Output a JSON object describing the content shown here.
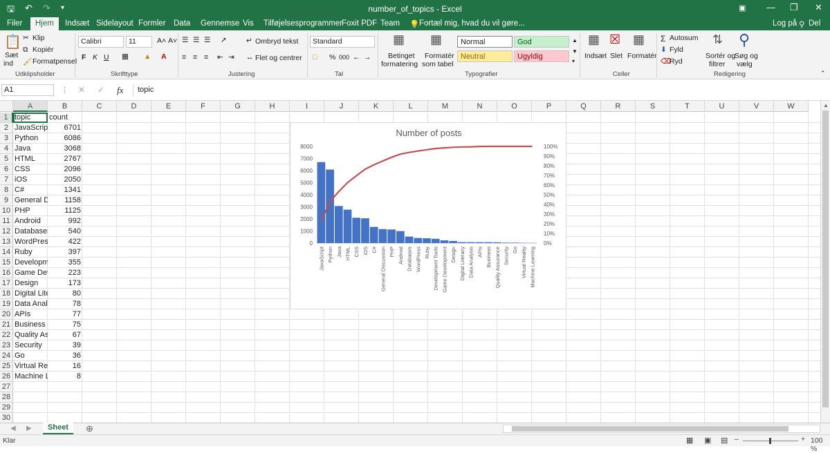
{
  "window": {
    "title": "number_of_topics - Excel",
    "user_label": "Log på",
    "share_label": "Del"
  },
  "menu": {
    "tabs": [
      "Filer",
      "Hjem",
      "Indsæt",
      "Sidelayout",
      "Formler",
      "Data",
      "Gennemse",
      "Vis",
      "Tilføjelsesprogrammer",
      "Foxit PDF",
      "Team"
    ],
    "active": "Hjem",
    "tellme": "Fortæl mig, hvad du vil gøre..."
  },
  "ribbon": {
    "clipboard": {
      "paste": "Sæt",
      "paste2": "ind",
      "cut": "Klip",
      "copy": "Kopiér",
      "format_painter": "Formatpensel",
      "group": "Udklipsholder"
    },
    "font": {
      "name": "Calibri",
      "size": "11",
      "bold": "F",
      "italic": "K",
      "underline": "U",
      "group": "Skrifttype"
    },
    "alignment": {
      "wrap": "Ombryd tekst",
      "merge": "Flet og centrer",
      "group": "Justering"
    },
    "number": {
      "format": "Standard",
      "percent": "%",
      "comma": "000",
      "group": "Tal"
    },
    "styles": {
      "conditional": "Betinget",
      "conditional2": "formatering",
      "as_table": "Formatér",
      "as_table2": "som tabel",
      "normal": "Normal",
      "good": "God",
      "neutral": "Neutral",
      "bad": "Ugyldig",
      "group": "Typografier"
    },
    "cells": {
      "insert": "Indsæt",
      "delete": "Slet",
      "format": "Formatér",
      "group": "Celler"
    },
    "editing": {
      "autosum": "Autosum",
      "fill": "Fyld",
      "clear": "Ryd",
      "sort": "Sortér og",
      "sort2": "filtrer",
      "find": "Søg og",
      "find2": "vælg",
      "group": "Redigering"
    }
  },
  "formula_bar": {
    "name_box": "A1",
    "fx": "fx",
    "content": "topic"
  },
  "columns": [
    "A",
    "B",
    "C",
    "D",
    "E",
    "F",
    "G",
    "H",
    "I",
    "J",
    "K",
    "L",
    "M",
    "N",
    "O",
    "P",
    "Q",
    "R",
    "S",
    "T",
    "U",
    "V",
    "W"
  ],
  "rows": [
    "1",
    "2",
    "3",
    "4",
    "5",
    "6",
    "7",
    "8",
    "9",
    "10",
    "11",
    "12",
    "13",
    "14",
    "15",
    "16",
    "17",
    "18",
    "19",
    "20",
    "21",
    "22",
    "23",
    "24",
    "25",
    "26",
    "27",
    "28",
    "29",
    "30"
  ],
  "cells": [
    [
      "topic",
      "count"
    ],
    [
      "JavaScript",
      "6701"
    ],
    [
      "Python",
      "6086"
    ],
    [
      "Java",
      "3068"
    ],
    [
      "HTML",
      "2767"
    ],
    [
      "CSS",
      "2096"
    ],
    [
      "iOS",
      "2050"
    ],
    [
      "C#",
      "1341"
    ],
    [
      "General Di",
      "1158"
    ],
    [
      "PHP",
      "1125"
    ],
    [
      "Android",
      "992"
    ],
    [
      "Databases",
      "540"
    ],
    [
      "WordPress",
      "422"
    ],
    [
      "Ruby",
      "397"
    ],
    [
      "Developme",
      "355"
    ],
    [
      "Game Dev",
      "223"
    ],
    [
      "Design",
      "173"
    ],
    [
      "Digital Lite",
      "80"
    ],
    [
      "Data Analy",
      "78"
    ],
    [
      "APIs",
      "77"
    ],
    [
      "Business",
      "75"
    ],
    [
      "Quality Ass",
      "67"
    ],
    [
      "Security",
      "39"
    ],
    [
      "Go",
      "36"
    ],
    [
      "Virtual Rea",
      "16"
    ],
    [
      "Machine L",
      "8"
    ]
  ],
  "chart_data": {
    "type": "bar",
    "title": "Number of posts",
    "categories": [
      "JavaScript",
      "Python",
      "Java",
      "HTML",
      "CSS",
      "iOS",
      "C#",
      "General Discussion",
      "PHP",
      "Android",
      "Databases",
      "WordPress",
      "Ruby",
      "Development Tools",
      "Game Development",
      "Design",
      "Digital Literacy",
      "Data Analysis",
      "APIs",
      "Business",
      "Quality Assurance",
      "Security",
      "Go",
      "Virtual Reality",
      "Machine Learning"
    ],
    "series": [
      {
        "type": "bar",
        "axis": "left",
        "color": "#4472c4",
        "values": [
          6701,
          6086,
          3068,
          2767,
          2096,
          2050,
          1341,
          1158,
          1125,
          992,
          540,
          422,
          397,
          355,
          223,
          173,
          80,
          78,
          77,
          75,
          67,
          39,
          36,
          16,
          8
        ]
      },
      {
        "type": "line",
        "axis": "right",
        "color": "#c0504d",
        "values": [
          22.5,
          43.0,
          53.3,
          62.6,
          69.6,
          76.5,
          81.0,
          84.9,
          88.7,
          92.0,
          93.8,
          95.2,
          96.6,
          97.8,
          98.5,
          99.1,
          99.4,
          99.6,
          99.9,
          100,
          100,
          100,
          100,
          100,
          100
        ]
      }
    ],
    "ylim": [
      0,
      8000
    ],
    "y_ticks": [
      "0",
      "1000",
      "2000",
      "3000",
      "4000",
      "5000",
      "6000",
      "7000",
      "8000"
    ],
    "y2lim": [
      0,
      100
    ],
    "y2_ticks": [
      "0%",
      "10%",
      "20%",
      "30%",
      "40%",
      "50%",
      "60%",
      "70%",
      "80%",
      "90%",
      "100%"
    ]
  },
  "sheet": {
    "tab": "Sheet"
  },
  "status": {
    "mode": "Klar",
    "zoom": "100 %"
  },
  "colors": {
    "accent": "#217346",
    "bar": "#4472c4",
    "line": "#c0504d"
  }
}
